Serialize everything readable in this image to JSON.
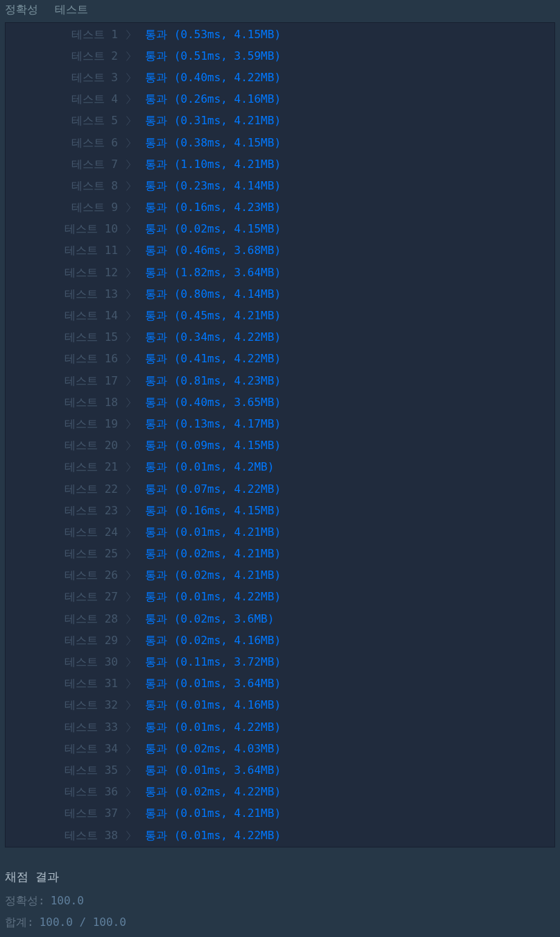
{
  "header": [
    "정확성",
    "테스트"
  ],
  "tests": [
    {
      "label": "테스트 1",
      "result": "통과 (0.53ms, 4.15MB)"
    },
    {
      "label": "테스트 2",
      "result": "통과 (0.51ms, 3.59MB)"
    },
    {
      "label": "테스트 3",
      "result": "통과 (0.40ms, 4.22MB)"
    },
    {
      "label": "테스트 4",
      "result": "통과 (0.26ms, 4.16MB)"
    },
    {
      "label": "테스트 5",
      "result": "통과 (0.31ms, 4.21MB)"
    },
    {
      "label": "테스트 6",
      "result": "통과 (0.38ms, 4.15MB)"
    },
    {
      "label": "테스트 7",
      "result": "통과 (1.10ms, 4.21MB)"
    },
    {
      "label": "테스트 8",
      "result": "통과 (0.23ms, 4.14MB)"
    },
    {
      "label": "테스트 9",
      "result": "통과 (0.16ms, 4.23MB)"
    },
    {
      "label": "테스트 10",
      "result": "통과 (0.02ms, 4.15MB)"
    },
    {
      "label": "테스트 11",
      "result": "통과 (0.46ms, 3.68MB)"
    },
    {
      "label": "테스트 12",
      "result": "통과 (1.82ms, 3.64MB)"
    },
    {
      "label": "테스트 13",
      "result": "통과 (0.80ms, 4.14MB)"
    },
    {
      "label": "테스트 14",
      "result": "통과 (0.45ms, 4.21MB)"
    },
    {
      "label": "테스트 15",
      "result": "통과 (0.34ms, 4.22MB)"
    },
    {
      "label": "테스트 16",
      "result": "통과 (0.41ms, 4.22MB)"
    },
    {
      "label": "테스트 17",
      "result": "통과 (0.81ms, 4.23MB)"
    },
    {
      "label": "테스트 18",
      "result": "통과 (0.40ms, 3.65MB)"
    },
    {
      "label": "테스트 19",
      "result": "통과 (0.13ms, 4.17MB)"
    },
    {
      "label": "테스트 20",
      "result": "통과 (0.09ms, 4.15MB)"
    },
    {
      "label": "테스트 21",
      "result": "통과 (0.01ms, 4.2MB)"
    },
    {
      "label": "테스트 22",
      "result": "통과 (0.07ms, 4.22MB)"
    },
    {
      "label": "테스트 23",
      "result": "통과 (0.16ms, 4.15MB)"
    },
    {
      "label": "테스트 24",
      "result": "통과 (0.01ms, 4.21MB)"
    },
    {
      "label": "테스트 25",
      "result": "통과 (0.02ms, 4.21MB)"
    },
    {
      "label": "테스트 26",
      "result": "통과 (0.02ms, 4.21MB)"
    },
    {
      "label": "테스트 27",
      "result": "통과 (0.01ms, 4.22MB)"
    },
    {
      "label": "테스트 28",
      "result": "통과 (0.02ms, 3.6MB)"
    },
    {
      "label": "테스트 29",
      "result": "통과 (0.02ms, 4.16MB)"
    },
    {
      "label": "테스트 30",
      "result": "통과 (0.11ms, 3.72MB)"
    },
    {
      "label": "테스트 31",
      "result": "통과 (0.01ms, 3.64MB)"
    },
    {
      "label": "테스트 32",
      "result": "통과 (0.01ms, 4.16MB)"
    },
    {
      "label": "테스트 33",
      "result": "통과 (0.01ms, 4.22MB)"
    },
    {
      "label": "테스트 34",
      "result": "통과 (0.02ms, 4.03MB)"
    },
    {
      "label": "테스트 35",
      "result": "통과 (0.01ms, 3.64MB)"
    },
    {
      "label": "테스트 36",
      "result": "통과 (0.02ms, 4.22MB)"
    },
    {
      "label": "테스트 37",
      "result": "통과 (0.01ms, 4.21MB)"
    },
    {
      "label": "테스트 38",
      "result": "통과 (0.01ms, 4.22MB)"
    }
  ],
  "summary": {
    "title": "채점 결과",
    "lines": [
      {
        "label": "정확성:",
        "value": "100.0"
      },
      {
        "label": "합계:",
        "value": "100.0 / 100.0"
      }
    ]
  }
}
